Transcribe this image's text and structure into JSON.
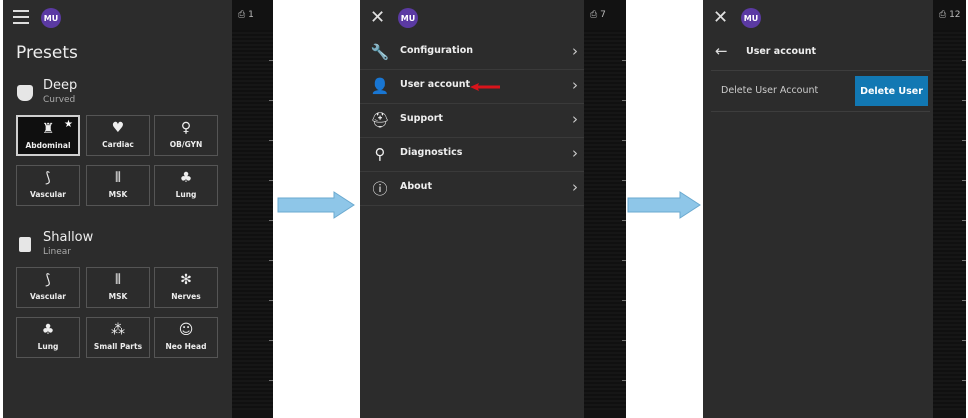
{
  "panel1": {
    "avatar": "MU",
    "count": "1",
    "title": "Presets",
    "groups": [
      {
        "name": "Deep",
        "sub": "Curved",
        "tiles": [
          {
            "label": "Abdominal",
            "icon": "abdominal-icon",
            "glyph": "♜",
            "selected": true
          },
          {
            "label": "Cardiac",
            "icon": "cardiac-icon",
            "glyph": "♥"
          },
          {
            "label": "OB/GYN",
            "icon": "obgyn-icon",
            "glyph": "♀"
          },
          {
            "label": "Vascular",
            "icon": "vascular-icon",
            "glyph": "⟆"
          },
          {
            "label": "MSK",
            "icon": "msk-icon",
            "glyph": "⦀"
          },
          {
            "label": "Lung",
            "icon": "lung-icon",
            "glyph": "♣"
          }
        ]
      },
      {
        "name": "Shallow",
        "sub": "Linear",
        "tiles": [
          {
            "label": "Vascular",
            "icon": "vascular-icon",
            "glyph": "⟆"
          },
          {
            "label": "MSK",
            "icon": "msk-icon",
            "glyph": "⦀"
          },
          {
            "label": "Nerves",
            "icon": "nerves-icon",
            "glyph": "✻"
          },
          {
            "label": "Lung",
            "icon": "lung-icon",
            "glyph": "♣"
          },
          {
            "label": "Small Parts",
            "icon": "small-parts-icon",
            "glyph": "⁂"
          },
          {
            "label": "Neo Head",
            "icon": "neo-head-icon",
            "glyph": "☺"
          }
        ]
      }
    ]
  },
  "panel2": {
    "avatar": "MU",
    "count": "7",
    "menu": [
      {
        "label": "Configuration",
        "icon": "wrench-icon",
        "glyph": "🔧"
      },
      {
        "label": "User account",
        "icon": "user-icon",
        "glyph": "👤"
      },
      {
        "label": "Support",
        "icon": "support-icon",
        "glyph": "⛑"
      },
      {
        "label": "Diagnostics",
        "icon": "diagnostics-icon",
        "glyph": "⚲"
      },
      {
        "label": "About",
        "icon": "info-icon",
        "glyph": "ⓘ"
      }
    ],
    "chevron": "›"
  },
  "panel3": {
    "avatar": "MU",
    "count": "12",
    "title": "User account",
    "row_label": "Delete User Account",
    "button": "Delete User"
  },
  "colors": {
    "panel_bg": "#2c2c2c",
    "avatar": "#5b3aa3",
    "button": "#1278b3",
    "flow_arrow": "#8ec6e8",
    "highlight_arrow": "#d9141b"
  }
}
